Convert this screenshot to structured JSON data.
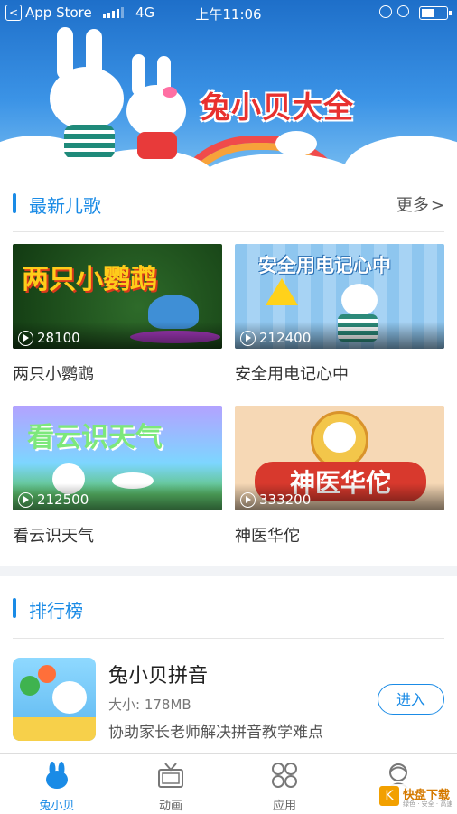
{
  "status_bar": {
    "back_glyph": "<",
    "carrier": "App Store",
    "network": "4G",
    "time": "上午11:06"
  },
  "banner": {
    "logo_text": "兔小贝大全"
  },
  "latest_songs": {
    "title": "最新儿歌",
    "more_label": "更多",
    "more_glyph": ">",
    "items": [
      {
        "name": "两只小鹦鹉",
        "art_title": "两只小鹦鹉",
        "plays": "28100"
      },
      {
        "name": "安全用电记心中",
        "art_title": "安全用电记心中",
        "plays": "212400"
      },
      {
        "name": "看云识天气",
        "art_title": "看云识天气",
        "plays": "212500"
      },
      {
        "name": "神医华佗",
        "art_title": "神医华佗",
        "plays": "333200"
      }
    ]
  },
  "ranking": {
    "title": "排行榜",
    "items": [
      {
        "name": "兔小贝拼音",
        "size": "大小:  178MB",
        "description": "协助家长老师解决拼音教学难点",
        "enter_label": "进入"
      }
    ]
  },
  "tab_bar": {
    "tabs": [
      {
        "label": "兔小贝",
        "icon": "bunny-icon",
        "active": true
      },
      {
        "label": "动画",
        "icon": "tv-icon",
        "active": false
      },
      {
        "label": "应用",
        "icon": "apps-grid-icon",
        "active": false
      },
      {
        "label": "",
        "icon": "profile-icon",
        "active": false
      }
    ]
  },
  "watermark": {
    "badge": "K",
    "text": "快盘下载",
    "subtext": "绿色 · 安全 · 高速"
  },
  "colors": {
    "accent": "#1a8be6",
    "banner_top": "#1e6fc9",
    "logo_red": "#e8312f"
  }
}
